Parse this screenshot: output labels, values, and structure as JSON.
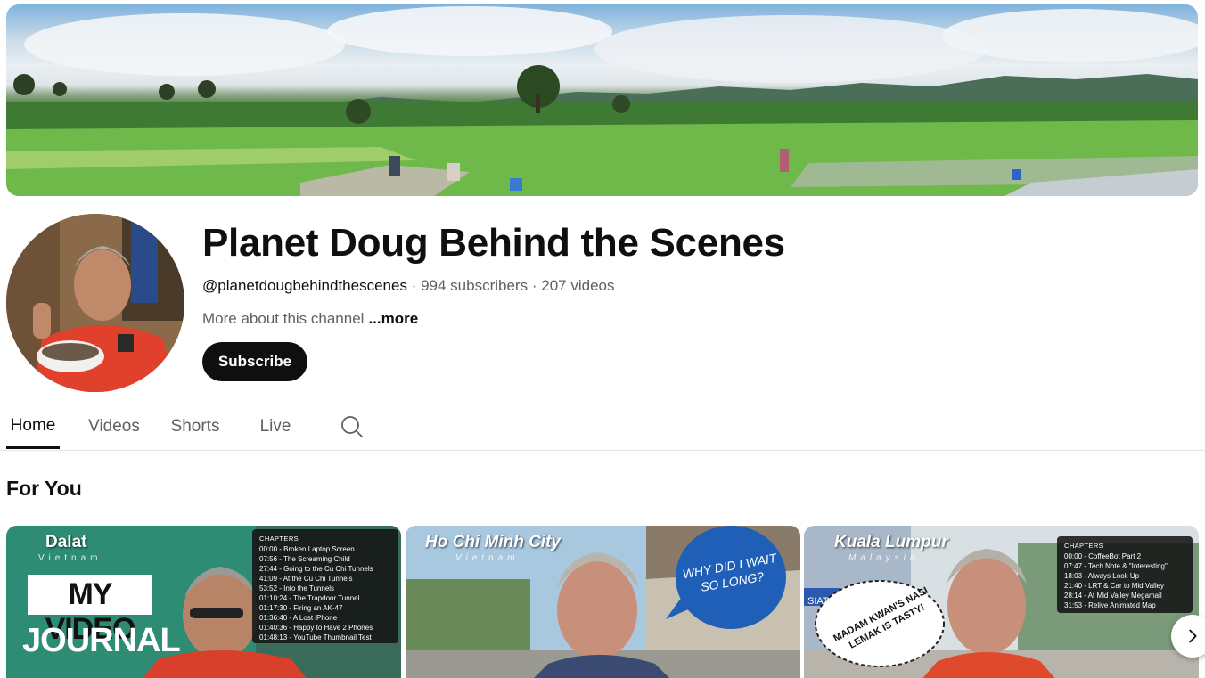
{
  "channel": {
    "title": "Planet Doug Behind the Scenes",
    "handle": "@planetdougbehindthescenes",
    "subscribers": "994 subscribers",
    "videos": "207 videos",
    "separator": "·",
    "about": "More about this channel",
    "more_label": "...more",
    "subscribe_label": "Subscribe"
  },
  "tabs": [
    {
      "label": "Home",
      "active": true
    },
    {
      "label": "Videos",
      "active": false
    },
    {
      "label": "Shorts",
      "active": false
    },
    {
      "label": "Live",
      "active": false
    }
  ],
  "section": {
    "title": "For You"
  },
  "videos": [
    {
      "city": "Dalat",
      "country": "Vietnam",
      "overlay_line1": "MY VIDEO",
      "overlay_line2": "JOURNAL",
      "chapters_heading": "CHAPTERS",
      "chapters": [
        "00:00 - Broken Laptop Screen",
        "07:56 - The Screaming Child",
        "27:44 - Going to the Cu Chi Tunnels",
        "41:09 - At the Cu Chi Tunnels",
        "53:52 - Into the Tunnels",
        "01:10:24 - The Trapdoor Tunnel",
        "01:17:30 - Firing an AK-47",
        "01:36:40 - A Lost iPhone",
        "01:40:36 - Happy to Have 2 Phones",
        "01:48:13 - YouTube Thumbnail Test"
      ]
    },
    {
      "city": "Ho Chi Minh City",
      "country": "Vietnam",
      "bubble_line1": "WHY DID I WAIT",
      "bubble_line2": "SO LONG?"
    },
    {
      "city": "Kuala Lumpur",
      "country": "Malaysia",
      "bubble_line1": "MADAM KWAN'S NASI",
      "bubble_line2": "LEMAK IS TASTY!",
      "sign_text": "SIAT",
      "chapters_heading": "CHAPTERS",
      "chapters": [
        "00:00 - CoffeeBot Part 2",
        "07:47 - Tech Note & \"Interesting\"",
        "18:03 - Always Look Up",
        "21:40 - LRT & Car to Mid Valley",
        "28:14 - At Mid Valley Megamall",
        "31:53 - Relive Animated Map"
      ]
    }
  ],
  "icons": {
    "search": "search-icon",
    "next": "chevron-right-icon"
  },
  "colors": {
    "text_primary": "#0f0f0f",
    "text_secondary": "#606060",
    "button_bg": "#0f0f0f",
    "divider": "#e5e5e5"
  }
}
